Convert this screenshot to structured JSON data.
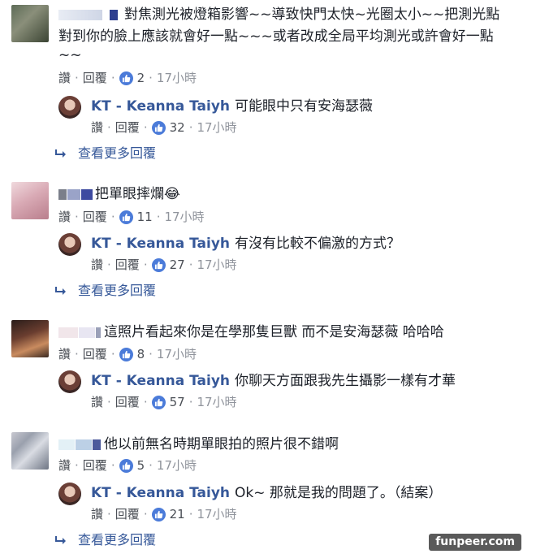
{
  "ui": {
    "like_label": "讚",
    "reply_label": "回覆",
    "dot": "·",
    "more_replies_label": "查看更多回覆",
    "watermark": "funpeer.com"
  },
  "comments": [
    {
      "text_line1": "對焦測光被燈箱影響~~導致快門太快~光圈太小~~把測光點",
      "text_line2": "對到你的臉上應該就會好一點~~~或者改成全局平均測光或許會好一點",
      "text_line3": "~~",
      "likes": "2",
      "time": "17小時",
      "reply": {
        "author": "KT - Keanna Taiyh",
        "text": "可能眼中只有安海瑟薇",
        "likes": "32",
        "time": "17小時"
      },
      "show_more": true
    },
    {
      "text_line1": "把單眼摔爛😂",
      "likes": "11",
      "time": "17小時",
      "reply": {
        "author": "KT - Keanna Taiyh",
        "text": "有沒有比較不偏激的方式？",
        "likes": "27",
        "time": "17小時"
      },
      "show_more": true
    },
    {
      "text_line1": "這照片看起來你是在學那隻巨獸 而不是安海瑟薇 哈哈哈",
      "likes": "8",
      "time": "17小時",
      "reply": {
        "author": "KT - Keanna Taiyh",
        "text": "你聊天方面跟我先生攝影一樣有才華",
        "likes": "57",
        "time": "17小時"
      },
      "show_more": false
    },
    {
      "text_line1": "他以前無名時期單眼拍的照片很不錯啊",
      "likes": "5",
      "time": "17小時",
      "reply": {
        "author": "KT - Keanna Taiyh",
        "text": "Ok~ 那就是我的問題了。（結案）",
        "likes": "21",
        "time": "17小時"
      },
      "show_more": true
    }
  ]
}
